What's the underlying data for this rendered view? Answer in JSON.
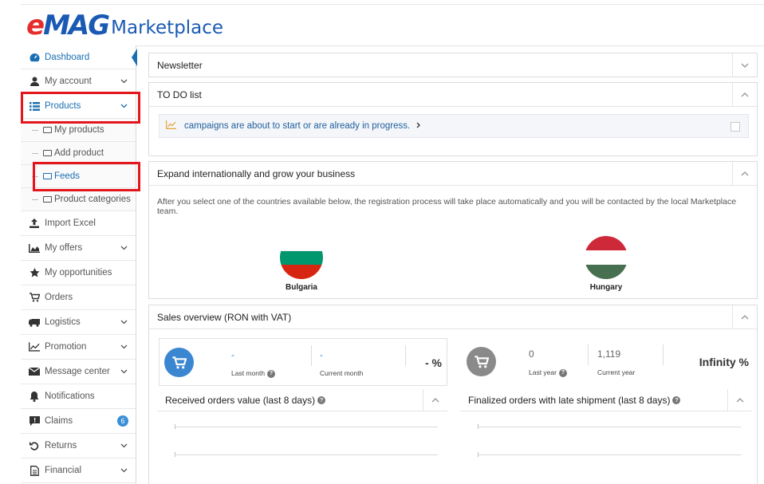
{
  "brand": {
    "logo_emag": "eMAG",
    "logo_marketplace": "Marketplace"
  },
  "sidebar": {
    "items": [
      {
        "label": "Dashboard",
        "icon": "dashboard-icon"
      },
      {
        "label": "My account",
        "icon": "user-icon"
      },
      {
        "label": "Products",
        "icon": "list-icon"
      },
      {
        "label": "Import Excel",
        "icon": "upload-icon"
      },
      {
        "label": "My offers",
        "icon": "area-chart-icon"
      },
      {
        "label": "My opportunities",
        "icon": "star-icon"
      },
      {
        "label": "Orders",
        "icon": "cart-icon"
      },
      {
        "label": "Logistics",
        "icon": "truck-icon"
      },
      {
        "label": "Promotion",
        "icon": "line-chart-icon"
      },
      {
        "label": "Message center",
        "icon": "envelope-icon"
      },
      {
        "label": "Notifications",
        "icon": "bell-icon"
      },
      {
        "label": "Claims",
        "icon": "comment-alert-icon",
        "badge": "6"
      },
      {
        "label": "Returns",
        "icon": "undo-icon"
      },
      {
        "label": "Financial",
        "icon": "file-icon"
      }
    ],
    "product_subitems": [
      "My products",
      "Add product",
      "Feeds",
      "Product categories"
    ]
  },
  "newsletter": {
    "title": "Newsletter"
  },
  "todo": {
    "title": "TO DO list",
    "item": "campaigns are about to start or are already in progress."
  },
  "international": {
    "title": "Expand internationally and grow your business",
    "text": "After you select one of the countries available below, the registration process will take place automatically and you will be contacted by the local Marketplace team.",
    "countries": [
      {
        "name": "Bulgaria",
        "colors": [
          "#ffffff",
          "#00966e",
          "#d62612"
        ]
      },
      {
        "name": "Hungary",
        "colors": [
          "#ce2939",
          "#ffffff",
          "#477050"
        ]
      }
    ]
  },
  "sales": {
    "title": "Sales overview (RON with VAT)",
    "monthly": {
      "last_value": "-",
      "last_label": "Last month",
      "current_value": "-",
      "current_label": "Current month",
      "percent": "- %"
    },
    "yearly": {
      "last_value": "0",
      "last_label": "Last year",
      "current_value": "1,119",
      "current_label": "Current year",
      "percent": "Infinity %"
    },
    "received_title": "Received orders value (last 8 days)",
    "late_title": "Finalized orders with late shipment (last 8 days)"
  },
  "colors": {
    "accent": "#1a6fb3",
    "highlight": "#e3161c",
    "kpi_blue": "#3b86d1",
    "kpi_grey": "#8a8a8a"
  }
}
